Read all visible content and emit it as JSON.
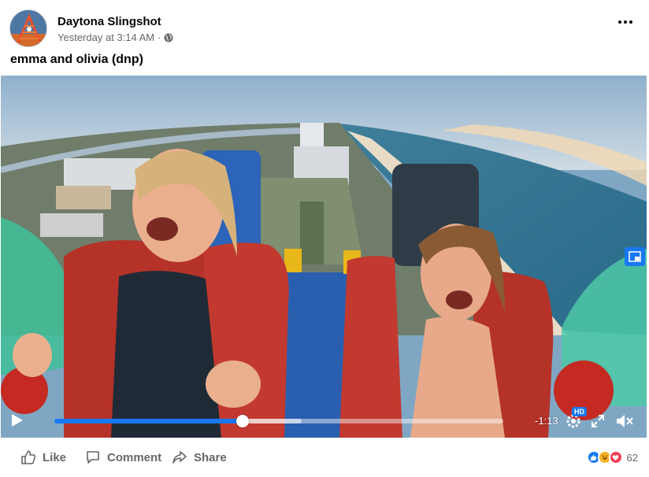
{
  "post": {
    "page_name": "Daytona Slingshot",
    "timestamp": "Yesterday at 3:14 AM",
    "separator": "·",
    "privacy_icon": "globe-icon",
    "caption": "emma and olivia (dnp)"
  },
  "video": {
    "time_remaining": "-1:13",
    "quality_badge": "HD",
    "progress": 0.42,
    "buffered": 0.55
  },
  "actions": {
    "like_label": "Like",
    "comment_label": "Comment",
    "share_label": "Share"
  },
  "reactions": {
    "types": [
      "like",
      "haha",
      "love"
    ],
    "count": "62"
  },
  "colors": {
    "accent": "#1877f2",
    "muted_text": "#65676b",
    "like": "#1877f2",
    "haha": "#f7b125",
    "love": "#f33e58"
  }
}
